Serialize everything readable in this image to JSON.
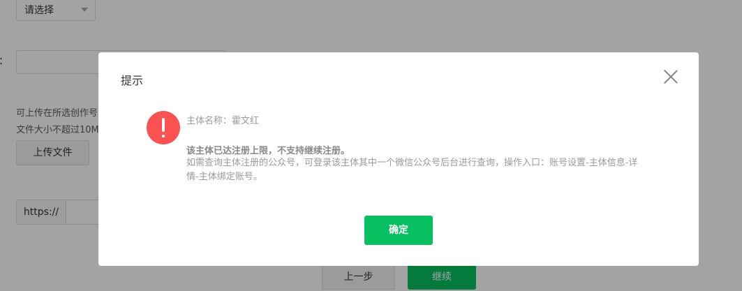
{
  "form": {
    "select_value": "请选择",
    "field_colon": "：",
    "upload_tip_line1": "可上传在所选创作号",
    "upload_tip_line2": "文件大小不超过10M",
    "upload_button": "上传文件",
    "url_prefix": "https://",
    "prev_button": "上一步",
    "next_button": "继续"
  },
  "dialog": {
    "title": "提示",
    "icon": "warning-icon",
    "subject_label": "主体名称：霍文红",
    "bold_message": "该主体已达注册上限，不支持继续注册。",
    "description": "如需查询主体注册的公众号，可登录该主体其中一个微信公众号后台进行查询，操作入口：账号设置-主体信息-详情-主体绑定账号。",
    "confirm_button": "确定"
  },
  "colors": {
    "primary": "#07c160",
    "warning": "#fa5151",
    "mask": "rgba(0,0,0,0.36)"
  }
}
